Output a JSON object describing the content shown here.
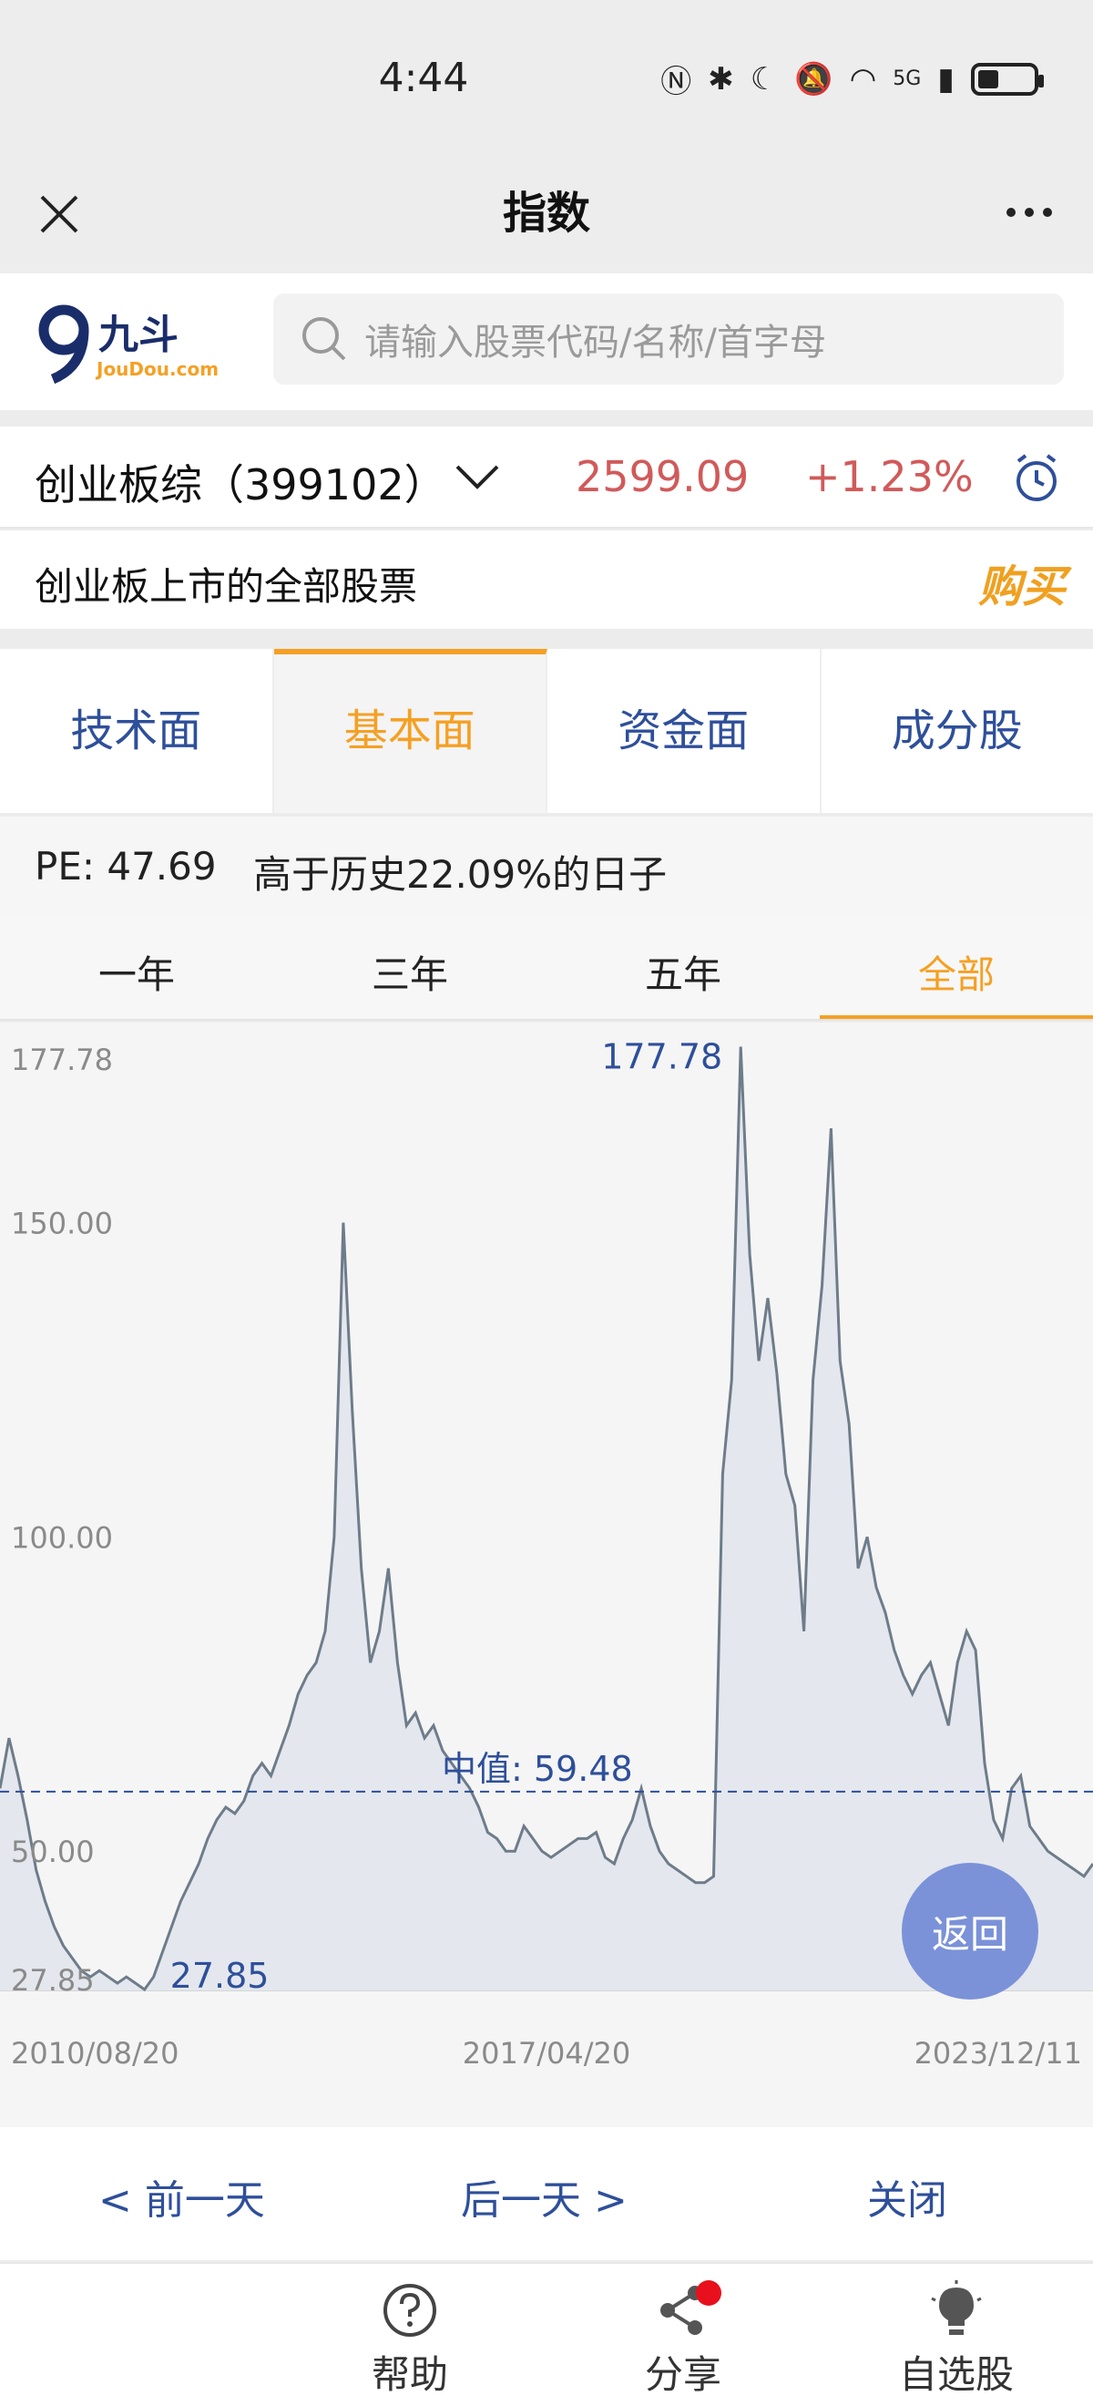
{
  "status": {
    "time": "4:44",
    "network": "5G"
  },
  "header": {
    "title": "指数"
  },
  "search": {
    "placeholder": "请输入股票代码/名称/首字母",
    "logo_cn": "九斗",
    "logo_en": "JouDou.com"
  },
  "index": {
    "name": "创业板综（399102）",
    "price": "2599.09",
    "change": "+1.23%"
  },
  "description": {
    "text": "创业板上市的全部股票",
    "buy_label": "购买"
  },
  "main_tabs": [
    {
      "label": "技术面",
      "active": false
    },
    {
      "label": "基本面",
      "active": true
    },
    {
      "label": "资金面",
      "active": false
    },
    {
      "label": "成分股",
      "active": false
    }
  ],
  "pe": {
    "label": "PE: 47.69",
    "desc": "高于历史22.09%的日子"
  },
  "period_tabs": [
    {
      "label": "一年",
      "active": false
    },
    {
      "label": "三年",
      "active": false
    },
    {
      "label": "五年",
      "active": false
    },
    {
      "label": "全部",
      "active": true
    }
  ],
  "chart_data": {
    "type": "area",
    "yticks": [
      "177.78",
      "150.00",
      "100.00",
      "50.00",
      "27.85"
    ],
    "xticks": [
      "2010/08/20",
      "2017/04/20",
      "2023/12/11"
    ],
    "max_label": "177.78",
    "min_label": "27.85",
    "median_label": "中值:",
    "median_value": "59.48",
    "ylim": [
      27.85,
      177.78
    ],
    "median": 59.48,
    "series": [
      {
        "values": [
          60,
          68,
          62,
          55,
          47,
          42,
          38,
          35,
          33,
          31,
          30,
          31,
          30,
          29,
          30,
          29,
          28,
          30,
          34,
          38,
          42,
          45,
          48,
          52,
          55,
          57,
          56,
          58,
          62,
          64,
          62,
          66,
          70,
          75,
          78,
          80,
          85,
          100,
          150,
          120,
          95,
          80,
          85,
          95,
          80,
          70,
          72,
          68,
          70,
          66,
          64,
          62,
          60,
          57,
          53,
          52,
          50,
          50,
          54,
          52,
          50,
          49,
          50,
          51,
          52,
          52,
          53,
          49,
          48,
          52,
          55,
          60,
          54,
          50,
          48,
          47,
          46,
          45,
          45,
          46,
          110,
          125,
          178,
          145,
          128,
          138,
          126,
          110,
          105,
          85,
          125,
          140,
          165,
          128,
          118,
          95,
          100,
          92,
          88,
          82,
          78,
          75,
          78,
          80,
          75,
          70,
          80,
          85,
          82,
          64,
          55,
          52,
          60,
          62,
          54,
          52,
          50,
          49,
          48,
          47,
          46,
          48
        ]
      }
    ]
  },
  "bottom_buttons": {
    "prev": "< 前一天",
    "next": "后一天 >",
    "close": "关闭"
  },
  "back_button": "返回",
  "nav": [
    {
      "label": "帮助",
      "icon": "help-icon"
    },
    {
      "label": "分享",
      "icon": "share-icon"
    },
    {
      "label": "自选股",
      "icon": "lightbulb-icon"
    }
  ],
  "colors": {
    "accent": "#f5a024",
    "blue": "#2e4f9a",
    "up": "#d15a5a",
    "line": "#6e7c8a",
    "fill": "#e4e7ee"
  }
}
